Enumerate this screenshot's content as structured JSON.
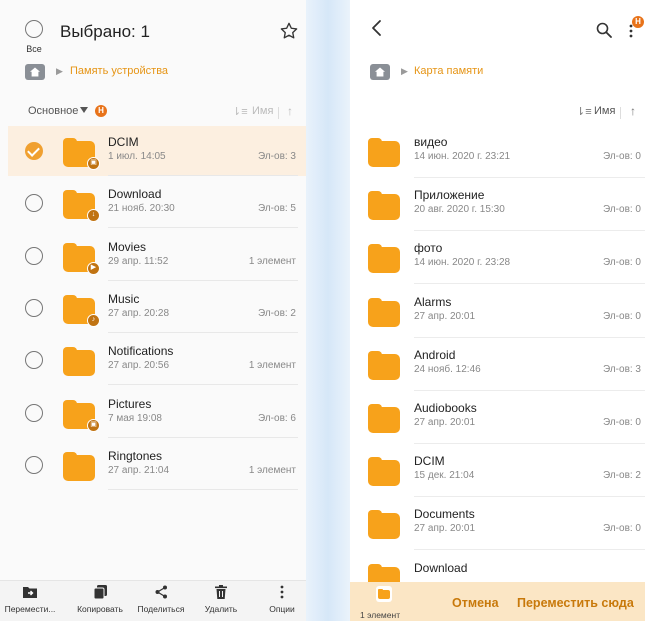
{
  "left": {
    "select_all_label": "Все",
    "title": "Выбрано: 1",
    "breadcrumb": "Память устройства",
    "sort": {
      "label": "Основное",
      "badge": "Н",
      "field": "Имя"
    },
    "items": [
      {
        "name": "DCIM",
        "date": "1 июл. 14:05",
        "count": "Эл-ов: 3",
        "selected": true,
        "sub": "img"
      },
      {
        "name": "Download",
        "date": "21 нояб. 20:30",
        "count": "Эл-ов: 5",
        "selected": false,
        "sub": "down"
      },
      {
        "name": "Movies",
        "date": "29 апр. 11:52",
        "count": "1 элемент",
        "selected": false,
        "sub": "play"
      },
      {
        "name": "Music",
        "date": "27 апр. 20:28",
        "count": "Эл-ов: 2",
        "selected": false,
        "sub": "note"
      },
      {
        "name": "Notifications",
        "date": "27 апр. 20:56",
        "count": "1 элемент",
        "selected": false,
        "sub": ""
      },
      {
        "name": "Pictures",
        "date": "7 мая 19:08",
        "count": "Эл-ов: 6",
        "selected": false,
        "sub": "img"
      },
      {
        "name": "Ringtones",
        "date": "27 апр. 21:04",
        "count": "1 элемент",
        "selected": false,
        "sub": ""
      }
    ],
    "toolbar": {
      "move": "Перемести...",
      "copy": "Копировать",
      "share": "Поделиться",
      "delete": "Удалить",
      "options": "Опции"
    }
  },
  "right": {
    "breadcrumb": "Карта памяти",
    "sort": {
      "field": "Имя"
    },
    "badge": "Н",
    "items": [
      {
        "name": "видео",
        "date": "14 июн. 2020 г. 23:21",
        "count": "Эл-ов: 0"
      },
      {
        "name": "Приложение",
        "date": "20 авг. 2020 г. 15:30",
        "count": "Эл-ов: 0"
      },
      {
        "name": "фото",
        "date": "14 июн. 2020 г. 23:28",
        "count": "Эл-ов: 0"
      },
      {
        "name": "Alarms",
        "date": "27 апр. 20:01",
        "count": "Эл-ов: 0"
      },
      {
        "name": "Android",
        "date": "24 нояб. 12:46",
        "count": "Эл-ов: 3"
      },
      {
        "name": "Audiobooks",
        "date": "27 апр. 20:01",
        "count": "Эл-ов: 0"
      },
      {
        "name": "DCIM",
        "date": "15 дек. 21:04",
        "count": "Эл-ов: 2"
      },
      {
        "name": "Documents",
        "date": "27 апр. 20:01",
        "count": "Эл-ов: 0"
      },
      {
        "name": "Download",
        "date": "",
        "count": ""
      }
    ],
    "bottom": {
      "selected_count": "1 элемент",
      "cancel": "Отмена",
      "move_here": "Переместить сюда"
    }
  },
  "colors": {
    "accent": "#f7a21b",
    "accent_text": "#c8790b",
    "badge": "#e8731a"
  }
}
